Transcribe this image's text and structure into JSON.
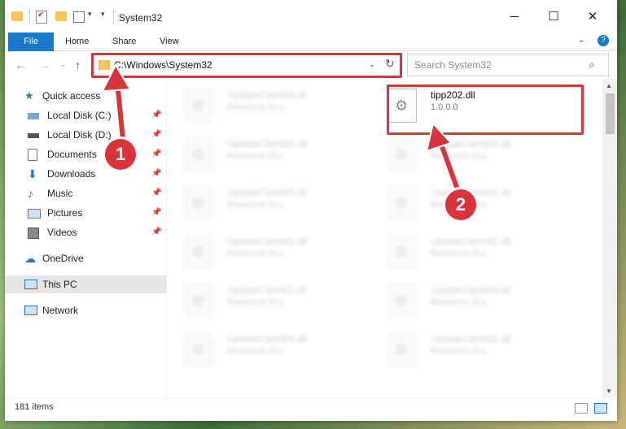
{
  "window": {
    "title": "System32"
  },
  "ribbon": {
    "tabs": [
      "File",
      "Home",
      "Share",
      "View"
    ]
  },
  "address": {
    "path": "C:\\Windows\\System32"
  },
  "search": {
    "placeholder": "Search System32"
  },
  "sidebar": {
    "quick_access": "Quick access",
    "items": [
      "Local Disk (C:)",
      "Local Disk (D:)",
      "Documents",
      "Downloads",
      "Music",
      "Pictures",
      "Videos"
    ],
    "onedrive": "OneDrive",
    "thispc": "This PC",
    "network": "Network"
  },
  "files": [
    {
      "name": "UpdateClient63.dll",
      "type": "Resource DLL"
    },
    {
      "name": "tipp202.dll",
      "type": "1.0.0.0"
    },
    {
      "name": "UpdateClient63.dll",
      "type": "Resource DLL"
    },
    {
      "name": "UpdateClient65.dll",
      "type": "Resource DLL"
    },
    {
      "name": "UpdateClient63.dll",
      "type": "Resource DLL"
    },
    {
      "name": "UpdateClient42.dll",
      "type": "Resource DLL"
    },
    {
      "name": "UpdateClient42.dll",
      "type": "Resource DLL"
    },
    {
      "name": "UpdateClient42.dll",
      "type": "Resource DLL"
    },
    {
      "name": "UpdateClient21.dll",
      "type": "Resource DLL"
    },
    {
      "name": "UpdateClient63.dll",
      "type": "Resource DLL"
    },
    {
      "name": "UpdateClient65.dll",
      "type": "Resource DLL"
    },
    {
      "name": "UpdateClient21.dll",
      "type": "Resource DLL"
    }
  ],
  "status": {
    "count": "181 items"
  },
  "annotations": {
    "one": "1",
    "two": "2"
  },
  "colors": {
    "accent": "#1979ca",
    "highlight": "#d9333b"
  }
}
